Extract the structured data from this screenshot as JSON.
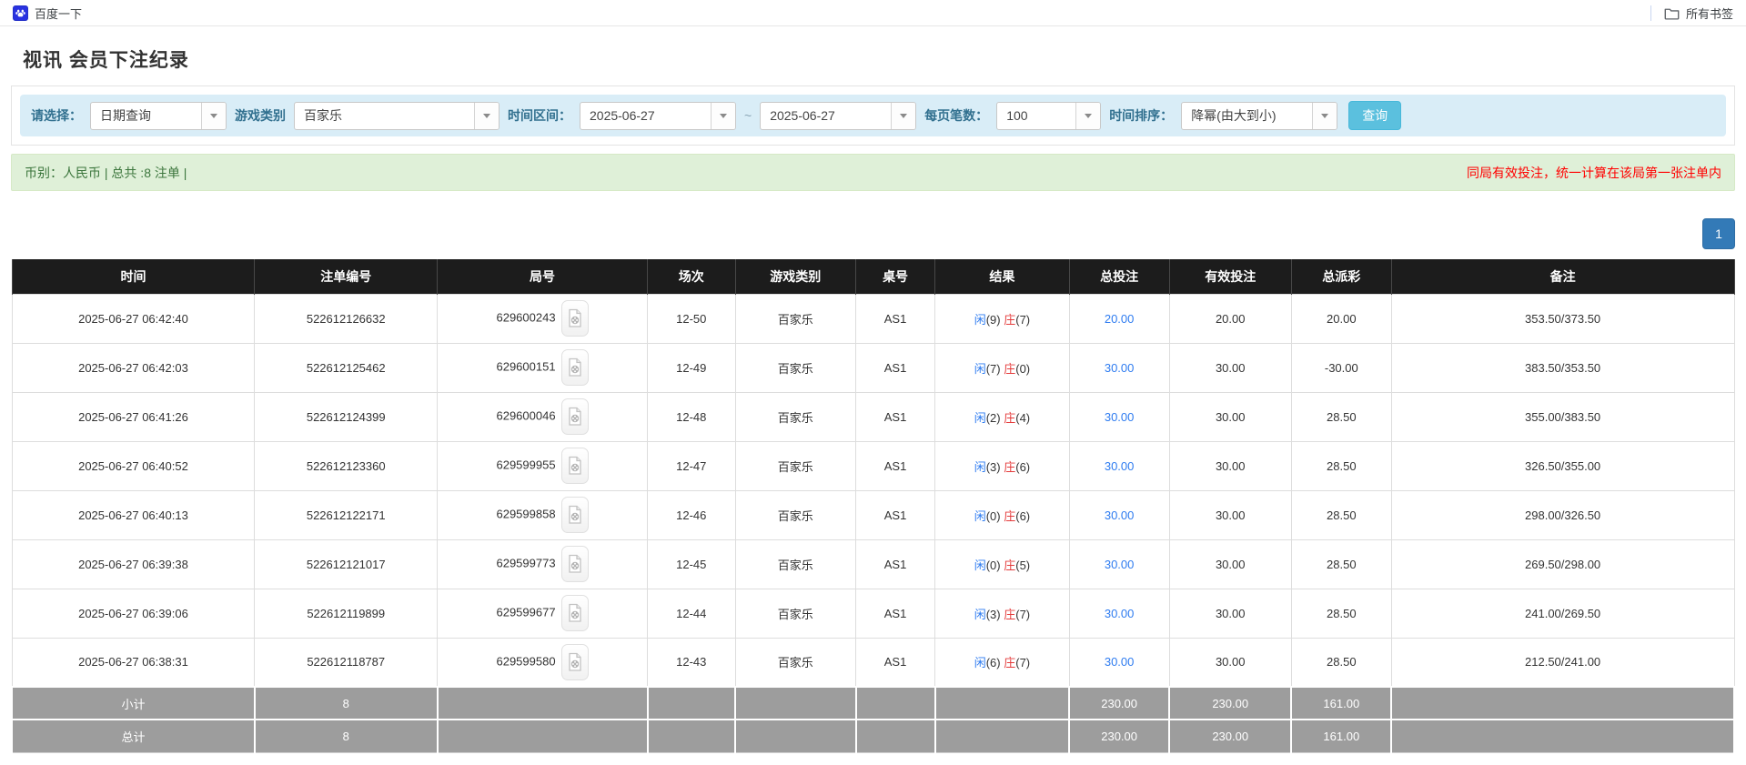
{
  "colors": {
    "filter_bg": "#d9edf7",
    "filter_label_blue": "#31708f",
    "query_button_blue": "#5bc0de",
    "summary_bg": "#dff0d8",
    "summary_text_green": "#3c763d",
    "note_red": "#ff0000",
    "pagination_blue": "#337ab7",
    "table_header_bg": "#1c1c1c",
    "table_footer_bg": "#9d9d9d",
    "link_blue": "#2d7bf0",
    "player_blue": "#2d7bf0",
    "banker_red": "#e43b3b",
    "negative_red": "#ee2222"
  },
  "browser": {
    "bookmark_label": "百度一下",
    "all_bookmarks_label": "所有书签"
  },
  "page": {
    "title": "视讯 会员下注纪录"
  },
  "filters": {
    "select_label": "请选择：",
    "select_value": "日期查询",
    "game_type_label": "游戏类别",
    "game_type_value": "百家乐",
    "date_range_label": "时间区间：",
    "date_from": "2025-06-27",
    "date_separator": "~",
    "date_to": "2025-06-27",
    "page_size_label": "每页笔数：",
    "page_size_value": "100",
    "sort_label": "时间排序：",
    "sort_value": "降幂(由大到小)",
    "query_button_label": "查询"
  },
  "summary": {
    "left_text": "币别：人民币 | 总共 :8 注单 |",
    "right_note": "同局有效投注，统一计算在该局第一张注单内"
  },
  "pagination": {
    "current_page": "1"
  },
  "table": {
    "headers": [
      "时间",
      "注单编号",
      "局号",
      "场次",
      "游戏类别",
      "桌号",
      "结果",
      "总投注",
      "有效投注",
      "总派彩",
      "备注"
    ],
    "rows": [
      {
        "time": "2025-06-27 06:42:40",
        "bet_id": "522612126632",
        "round_id": "629600243",
        "session": "12-50",
        "game": "百家乐",
        "table_no": "AS1",
        "player_label": "闲",
        "player_score": "(9)",
        "banker_label": "庄",
        "banker_score": "(7)",
        "total_bet": "20.00",
        "valid_bet": "20.00",
        "payout": "20.00",
        "remark": "353.50/373.50"
      },
      {
        "time": "2025-06-27 06:42:03",
        "bet_id": "522612125462",
        "round_id": "629600151",
        "session": "12-49",
        "game": "百家乐",
        "table_no": "AS1",
        "player_label": "闲",
        "player_score": "(7)",
        "banker_label": "庄",
        "banker_score": "(0)",
        "total_bet": "30.00",
        "valid_bet": "30.00",
        "payout": "-30.00",
        "remark": "383.50/353.50"
      },
      {
        "time": "2025-06-27 06:41:26",
        "bet_id": "522612124399",
        "round_id": "629600046",
        "session": "12-48",
        "game": "百家乐",
        "table_no": "AS1",
        "player_label": "闲",
        "player_score": "(2)",
        "banker_label": "庄",
        "banker_score": "(4)",
        "total_bet": "30.00",
        "valid_bet": "30.00",
        "payout": "28.50",
        "remark": "355.00/383.50"
      },
      {
        "time": "2025-06-27 06:40:52",
        "bet_id": "522612123360",
        "round_id": "629599955",
        "session": "12-47",
        "game": "百家乐",
        "table_no": "AS1",
        "player_label": "闲",
        "player_score": "(3)",
        "banker_label": "庄",
        "banker_score": "(6)",
        "total_bet": "30.00",
        "valid_bet": "30.00",
        "payout": "28.50",
        "remark": "326.50/355.00"
      },
      {
        "time": "2025-06-27 06:40:13",
        "bet_id": "522612122171",
        "round_id": "629599858",
        "session": "12-46",
        "game": "百家乐",
        "table_no": "AS1",
        "player_label": "闲",
        "player_score": "(0)",
        "banker_label": "庄",
        "banker_score": "(6)",
        "total_bet": "30.00",
        "valid_bet": "30.00",
        "payout": "28.50",
        "remark": "298.00/326.50"
      },
      {
        "time": "2025-06-27 06:39:38",
        "bet_id": "522612121017",
        "round_id": "629599773",
        "session": "12-45",
        "game": "百家乐",
        "table_no": "AS1",
        "player_label": "闲",
        "player_score": "(0)",
        "banker_label": "庄",
        "banker_score": "(5)",
        "total_bet": "30.00",
        "valid_bet": "30.00",
        "payout": "28.50",
        "remark": "269.50/298.00"
      },
      {
        "time": "2025-06-27 06:39:06",
        "bet_id": "522612119899",
        "round_id": "629599677",
        "session": "12-44",
        "game": "百家乐",
        "table_no": "AS1",
        "player_label": "闲",
        "player_score": "(3)",
        "banker_label": "庄",
        "banker_score": "(7)",
        "total_bet": "30.00",
        "valid_bet": "30.00",
        "payout": "28.50",
        "remark": "241.00/269.50"
      },
      {
        "time": "2025-06-27 06:38:31",
        "bet_id": "522612118787",
        "round_id": "629599580",
        "session": "12-43",
        "game": "百家乐",
        "table_no": "AS1",
        "player_label": "闲",
        "player_score": "(6)",
        "banker_label": "庄",
        "banker_score": "(7)",
        "total_bet": "30.00",
        "valid_bet": "30.00",
        "payout": "28.50",
        "remark": "212.50/241.00"
      }
    ],
    "footer": [
      {
        "label": "小计",
        "count": "8",
        "total_bet": "230.00",
        "valid_bet": "230.00",
        "payout": "161.00"
      },
      {
        "label": "总计",
        "count": "8",
        "total_bet": "230.00",
        "valid_bet": "230.00",
        "payout": "161.00"
      }
    ]
  }
}
